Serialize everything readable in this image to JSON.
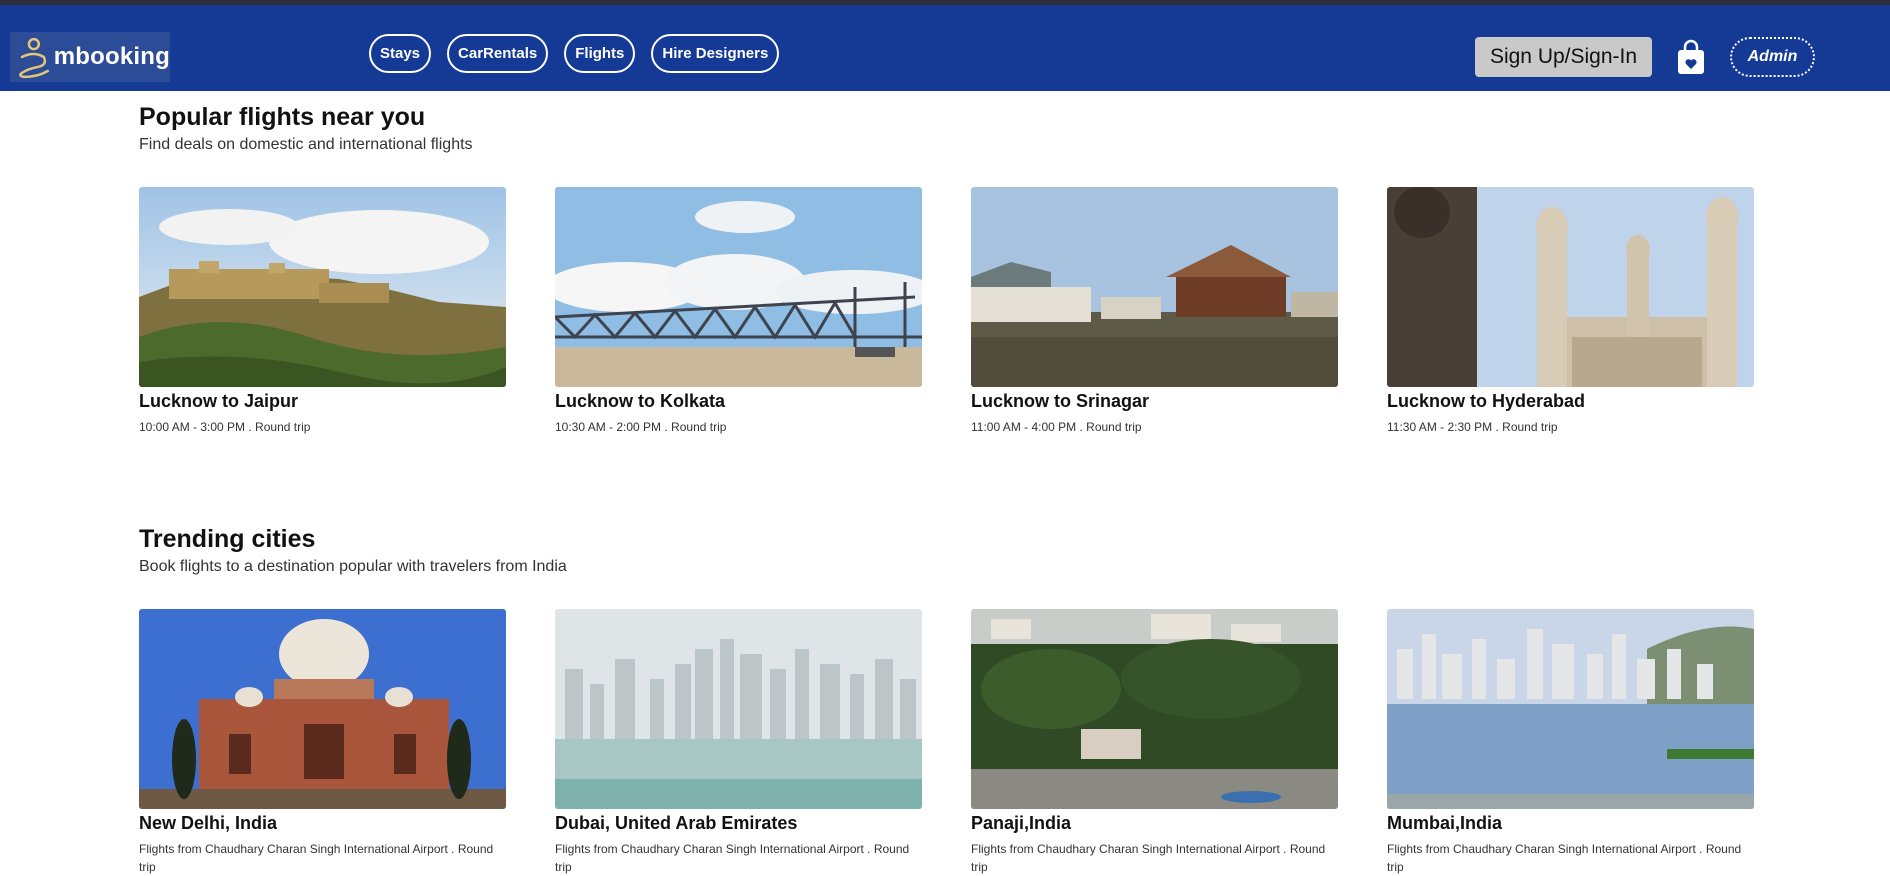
{
  "header": {
    "logo_text": "mbooking",
    "nav": [
      {
        "label": "Stays"
      },
      {
        "label": "CarRentals"
      },
      {
        "label": "Flights"
      },
      {
        "label": "Hire Designers"
      }
    ],
    "signup_label": "Sign Up/Sign-In",
    "cart_icon": "shopping-bag-icon",
    "admin_label": "Admin"
  },
  "colors": {
    "header_bg": "#153a96",
    "signup_bg": "#c9c9c9"
  },
  "popular": {
    "title": "Popular flights near you",
    "subtitle": "Find deals on domestic and international flights",
    "cards": [
      {
        "title": "Lucknow to Jaipur",
        "desc": "10:00 AM - 3:00 PM . Round trip",
        "image": "amber-fort"
      },
      {
        "title": "Lucknow to Kolkata",
        "desc": "10:30 AM - 2:00 PM . Round trip",
        "image": "howrah-bridge"
      },
      {
        "title": "Lucknow to Srinagar",
        "desc": "11:00 AM - 4:00 PM . Round trip",
        "image": "dal-lake-houseboat"
      },
      {
        "title": "Lucknow to Hyderabad",
        "desc": "11:30 AM - 2:30 PM . Round trip",
        "image": "charminar"
      }
    ]
  },
  "trending": {
    "title": "Trending cities",
    "subtitle": "Book flights to a destination popular with travelers from India",
    "cards": [
      {
        "title": "New Delhi, India",
        "desc": "Flights from Chaudhary Charan Singh International Airport . Round trip",
        "image": "humayun-tomb"
      },
      {
        "title": "Dubai, United Arab Emirates",
        "desc": "Flights from Chaudhary Charan Singh International Airport . Round trip",
        "image": "dubai-skyline"
      },
      {
        "title": "Panaji,India",
        "desc": "Flights from Chaudhary Charan Singh International Airport . Round trip",
        "image": "panaji-coast"
      },
      {
        "title": "Mumbai,India",
        "desc": "Flights from Chaudhary Charan Singh International Airport . Round trip",
        "image": "mumbai-skyline"
      }
    ]
  }
}
